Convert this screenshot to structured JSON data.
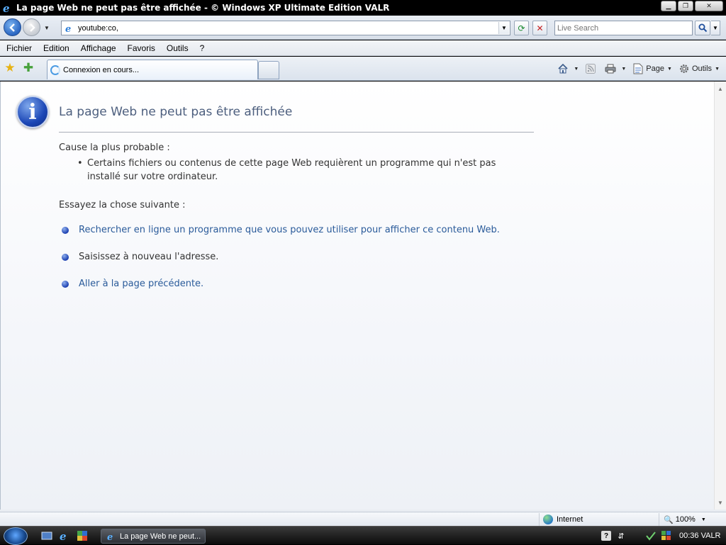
{
  "window": {
    "title": "La page Web ne peut pas être affichée - © Windows XP Ultimate Edition VALR"
  },
  "address": {
    "url": "youtube:co,",
    "search_placeholder": "Live Search"
  },
  "menu": [
    "Fichier",
    "Edition",
    "Affichage",
    "Favoris",
    "Outils",
    "?"
  ],
  "tab": {
    "label": "Connexion en cours..."
  },
  "commandbar": {
    "page_label": "Page",
    "tools_label": "Outils"
  },
  "content": {
    "title": "La page Web ne peut pas être affichée",
    "cause_heading": "Cause la plus probable :",
    "cause_item": "Certains fichiers ou contenus de cette page Web requièrent un programme qui n'est pas installé sur votre ordinateur.",
    "try_heading": "Essayez la chose suivante :",
    "options": [
      "Rechercher en ligne un programme que vous pouvez utiliser pour afficher ce contenu Web.",
      "Saisissez à nouveau l'adresse.",
      "Aller à la page précédente."
    ]
  },
  "statusbar": {
    "zone": "Internet",
    "zoom": "100%"
  },
  "taskbar": {
    "active_window": "La page Web ne peut...",
    "clock": "00:36 VALR"
  },
  "colors": {
    "link": "#2a5b9a",
    "title": "#4d5f7e",
    "info_icon": "#1c47b6"
  }
}
